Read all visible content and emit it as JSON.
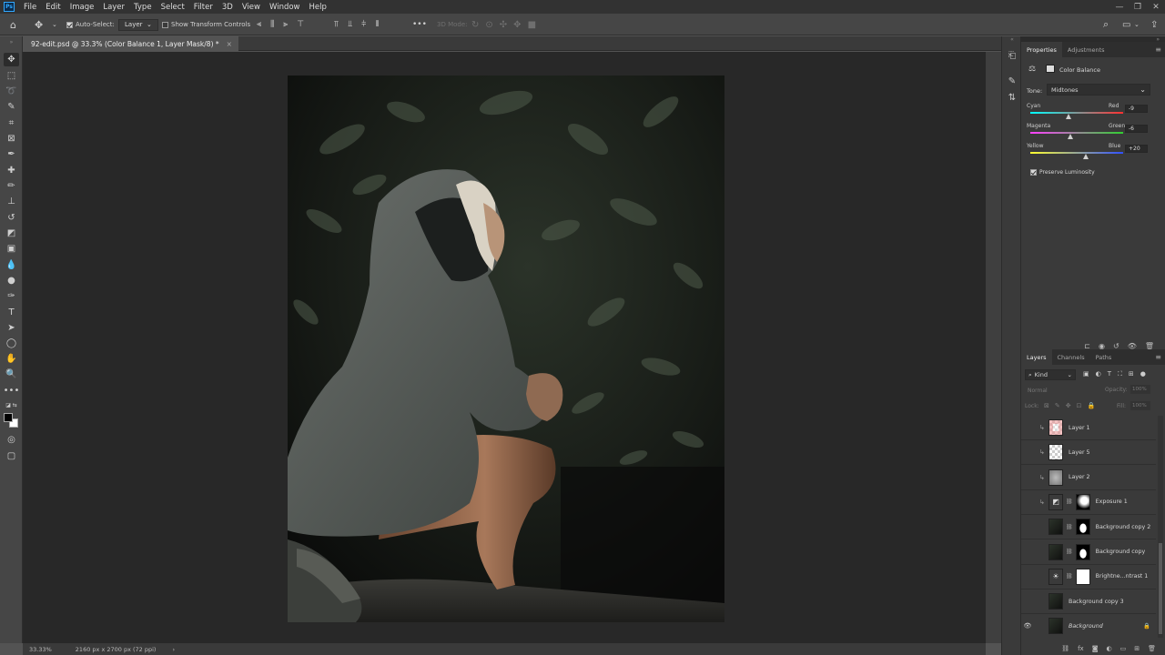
{
  "app": {
    "logo": "Ps"
  },
  "menu": [
    "File",
    "Edit",
    "Image",
    "Layer",
    "Type",
    "Select",
    "Filter",
    "3D",
    "View",
    "Window",
    "Help"
  ],
  "options": {
    "auto_select_label": "Auto-Select:",
    "auto_select_value": "Layer",
    "show_transform_label": "Show Transform Controls",
    "mode_3d_label": "3D Mode:",
    "more_label": "•••"
  },
  "document": {
    "tab_title": "92-edit.psd @ 33.3% (Color Balance 1, Layer Mask/8) *",
    "close_glyph": "×",
    "zoom": "33.33%",
    "info": "2160 px x 2700 px (72 ppi)"
  },
  "properties": {
    "tabs": [
      "Properties",
      "Adjustments"
    ],
    "adjustment_name": "Color Balance",
    "tone_label": "Tone:",
    "tone_value": "Midtones",
    "sliders": [
      {
        "left": "Cyan",
        "right": "Red",
        "value": "-9",
        "position": 0.41,
        "colors": [
          "#00ffff",
          "#ff3030"
        ]
      },
      {
        "left": "Magenta",
        "right": "Green",
        "value": "-6",
        "position": 0.43,
        "colors": [
          "#ff40ff",
          "#30d030"
        ]
      },
      {
        "left": "Yellow",
        "right": "Blue",
        "value": "+20",
        "position": 0.6,
        "colors": [
          "#ffff30",
          "#3050ff"
        ]
      }
    ],
    "preserve_luminosity": "Preserve Luminosity"
  },
  "layers": {
    "tabs": [
      "Layers",
      "Channels",
      "Paths"
    ],
    "filter_kind": "Kind",
    "blend_mode": "Normal",
    "opacity_label": "Opacity:",
    "opacity_value": "100%",
    "lock_label": "Lock:",
    "fill_label": "Fill:",
    "fill_value": "100%",
    "items": [
      {
        "name": "Layer 1",
        "thumb": "checker-red",
        "clipped": true,
        "visible": false
      },
      {
        "name": "Layer 5",
        "thumb": "checker",
        "clipped": true,
        "visible": false
      },
      {
        "name": "Layer 2",
        "thumb": "gray",
        "clipped": true,
        "visible": false
      },
      {
        "name": "Exposure 1",
        "thumb": "adjust",
        "mask": "black-white",
        "clipped": true,
        "visible": false
      },
      {
        "name": "Background copy 2",
        "thumb": "photo",
        "mask": "silhouette",
        "visible": false
      },
      {
        "name": "Background copy",
        "thumb": "photo",
        "mask": "silhouette",
        "visible": false
      },
      {
        "name": "Brightne...ntrast 1",
        "thumb": "sun",
        "mask": "white",
        "visible": false
      },
      {
        "name": "Background copy 3",
        "thumb": "photo",
        "visible": false
      },
      {
        "name": "Background",
        "thumb": "photo",
        "visible": true,
        "locked": true
      }
    ]
  },
  "colors": {
    "accent": "#31a8ff",
    "panel": "#3a3a3a",
    "canvas_bg": "#282828"
  }
}
